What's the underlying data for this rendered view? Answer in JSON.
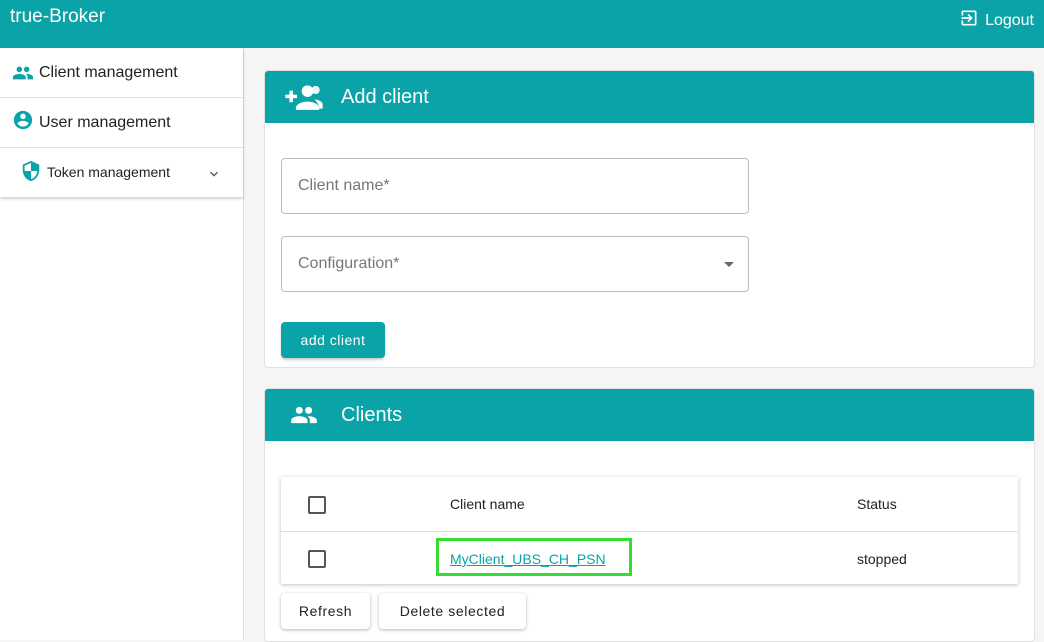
{
  "app": {
    "title": "true-Broker",
    "logout_label": "Logout"
  },
  "sidebar": {
    "items": [
      {
        "label": "Client management",
        "icon": "people-icon"
      },
      {
        "label": "User management",
        "icon": "account-circle-icon"
      },
      {
        "label": "Token management",
        "icon": "shield-icon"
      }
    ]
  },
  "add_client": {
    "title": "Add client",
    "client_name_placeholder": "Client name*",
    "configuration_placeholder": "Configuration*",
    "submit_label": "add client"
  },
  "clients": {
    "title": "Clients",
    "columns": {
      "name": "Client name",
      "status": "Status"
    },
    "rows": [
      {
        "name": "MyClient_UBS_CH_PSN",
        "status": "stopped"
      }
    ],
    "refresh_label": "Refresh",
    "delete_label": "Delete selected"
  },
  "colors": {
    "accent": "#0aa4a8",
    "highlight": "#33dd33"
  }
}
